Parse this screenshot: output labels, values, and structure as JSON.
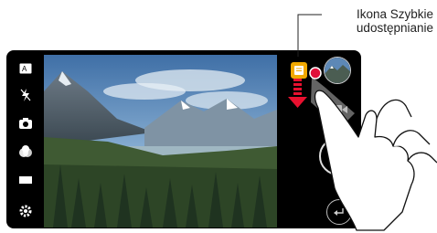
{
  "callout": {
    "line1": "Ikona Szybkie",
    "line2": "udostępnianie"
  },
  "left_toolbar": {
    "items": [
      {
        "icon": "ai-cam-icon"
      },
      {
        "icon": "flash-off-icon"
      },
      {
        "icon": "switch-camera-icon"
      },
      {
        "icon": "filter-icon"
      },
      {
        "icon": "aspect-ratio-icon"
      },
      {
        "icon": "settings-gear-icon"
      }
    ]
  },
  "right_toolbar": {
    "quick_share_icon": "quick-share-icon",
    "gallery_thumbnail": "gallery-preview-thumbnail",
    "video_icon": "video-record-icon",
    "shutter": "shutter-button",
    "back": "back-icon"
  },
  "colors": {
    "quick_share": "#f0a800",
    "pointer_red": "#e0103a",
    "arrow_red": "#e8102f"
  }
}
